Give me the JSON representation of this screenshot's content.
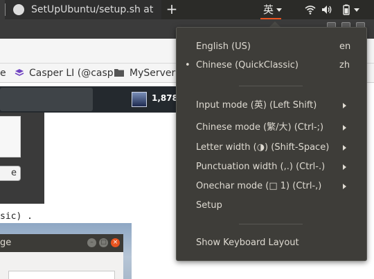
{
  "panel": {
    "ime_indicator": "英",
    "icons": [
      "wifi-icon",
      "volume-icon",
      "battery-icon"
    ]
  },
  "browser": {
    "tab_title": "SetUpUbuntu/setup.sh at",
    "new_tab_label": "+",
    "bookmarks": [
      {
        "label": "e"
      },
      {
        "label": "Casper LI (@casp"
      },
      {
        "label": "MyServer"
      }
    ]
  },
  "page": {
    "avatar_count": "1,878",
    "button_fragment": "e",
    "code_fragment": "sic) .",
    "dialog_title_fragment": "ge"
  },
  "menu": {
    "items": [
      {
        "label": "English (US)",
        "shortcut": "en",
        "selected": false
      },
      {
        "label": "Chinese (QuickClassic)",
        "shortcut": "zh",
        "selected": true
      },
      {
        "label": "Input mode (英) (Left Shift)",
        "submenu": true
      },
      {
        "label": "Chinese mode (繁/大) (Ctrl-;)",
        "submenu": true
      },
      {
        "label": "Letter width (◑) (Shift-Space)",
        "submenu": true
      },
      {
        "label": "Punctuation width (,.) (Ctrl-.)",
        "submenu": true
      },
      {
        "label": "Onechar mode (□ 1) (Ctrl-,)",
        "submenu": true
      },
      {
        "label": "Setup",
        "submenu": false
      },
      {
        "label": "Show Keyboard Layout",
        "submenu": false
      }
    ],
    "selected_marker": "•"
  },
  "colors": {
    "panel_bg": "#2b2b28",
    "menu_bg": "#3e3d39",
    "accent": "#e95420",
    "menu_text": "#dfdbd2"
  }
}
